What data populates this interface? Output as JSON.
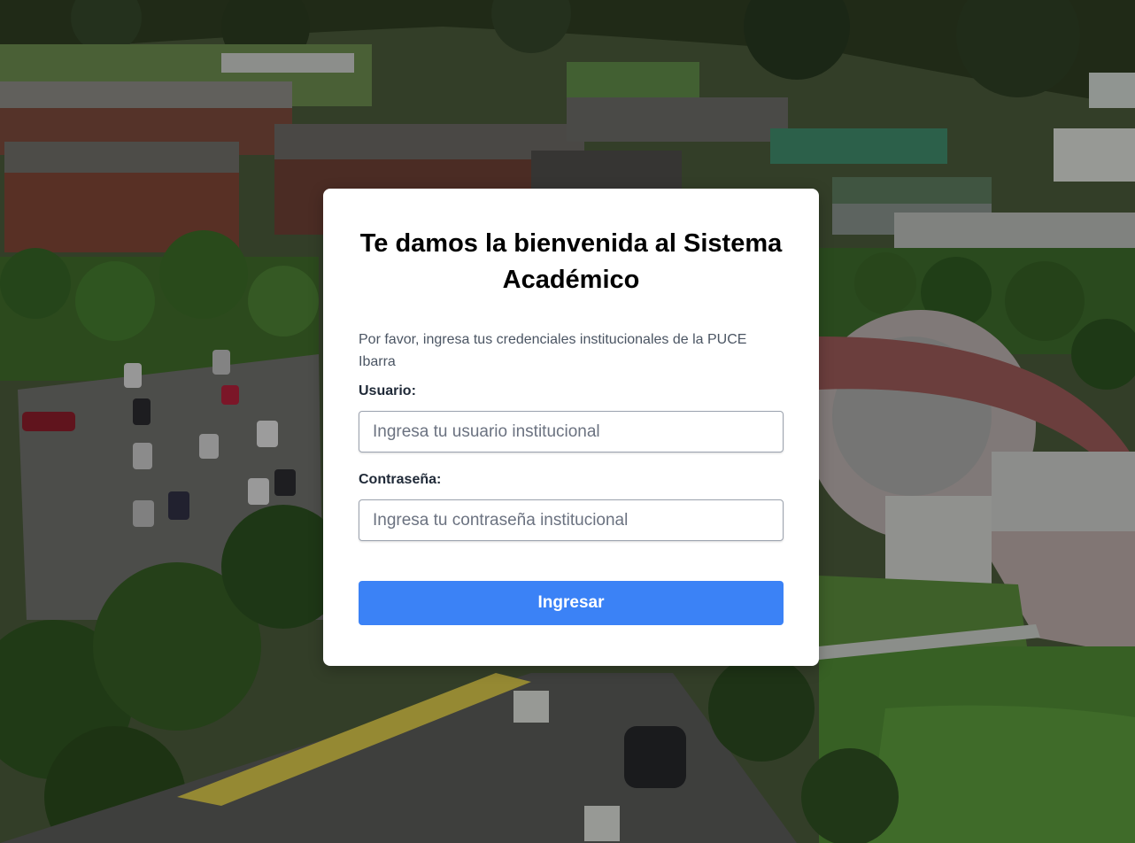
{
  "background": {
    "description_icon": "campus-aerial-photo-icon",
    "overlay_color": "#000000"
  },
  "login": {
    "title": "Te damos la bienvenida al Sistema Académico",
    "intro": "Por favor, ingresa tus credenciales institucionales de la PUCE Ibarra",
    "username_label": "Usuario:",
    "username_placeholder": "Ingresa tu usuario institucional",
    "username_value": "",
    "password_label": "Contraseña:",
    "password_placeholder": "Ingresa tu contraseña institucional",
    "password_value": "",
    "submit_label": "Ingresar",
    "accent_color": "#3b82f6"
  }
}
